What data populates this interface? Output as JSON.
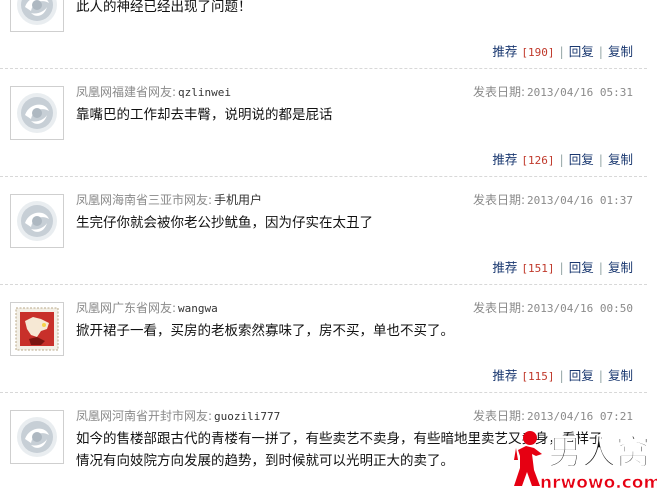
{
  "comments": [
    {
      "header": null,
      "avatar": "ifeng-logo-avatar",
      "text": "此人的神经已经出现了问题！",
      "actions": {
        "recommend_label": "推荐",
        "recommend_count": "[190]",
        "reply_label": "回复",
        "copy_label": "复制"
      }
    },
    {
      "header": {
        "source": "凤凰网福建省网友:",
        "user": "qzlinwei",
        "date_label": "发表日期:",
        "date": "2013/04/16 05:31"
      },
      "avatar": "ifeng-logo-avatar",
      "text": "靠嘴巴的工作却去丰臀，说明说的都是屁话",
      "actions": {
        "recommend_label": "推荐",
        "recommend_count": "[126]",
        "reply_label": "回复",
        "copy_label": "复制"
      }
    },
    {
      "header": {
        "source": "凤凰网海南省三亚市网友:",
        "user": "手机用户",
        "date_label": "发表日期:",
        "date": "2013/04/16 01:37"
      },
      "avatar": "ifeng-logo-avatar",
      "text": "生完仔你就会被你老公抄鱿鱼，因为仔实在太丑了",
      "actions": {
        "recommend_label": "推荐",
        "recommend_count": "[151]",
        "reply_label": "回复",
        "copy_label": "复制"
      }
    },
    {
      "header": {
        "source": "凤凰网广东省网友:",
        "user": "wangwa",
        "date_label": "发表日期:",
        "date": "2013/04/16 00:50"
      },
      "avatar": "stamp-map-avatar",
      "text": "掀开裙子一看，买房的老板索然寡味了，房不买，单也不买了。",
      "actions": {
        "recommend_label": "推荐",
        "recommend_count": "[115]",
        "reply_label": "回复",
        "copy_label": "复制"
      }
    },
    {
      "header": {
        "source": "凤凰网河南省开封市网友:",
        "user": "guozili777",
        "date_label": "发表日期:",
        "date": "2013/04/16 07:21"
      },
      "avatar": "ifeng-logo-avatar",
      "text_lines": [
        "如今的售楼部跟古代的青楼有一拼了，有些卖艺不卖身，有些暗地里卖艺又卖身，看样子",
        "情况有向妓院方向发展的趋势，到时候就可以光明正大的卖了。"
      ],
      "actions": null
    }
  ],
  "watermark": {
    "brand_text": "男人窝",
    "url_text": "nrwowo.com",
    "colors": {
      "red": "#e60012",
      "black": "#111111"
    }
  },
  "colors": {
    "link": "#1a3870",
    "count": "#c0392b",
    "meta": "#8a8a8a"
  }
}
